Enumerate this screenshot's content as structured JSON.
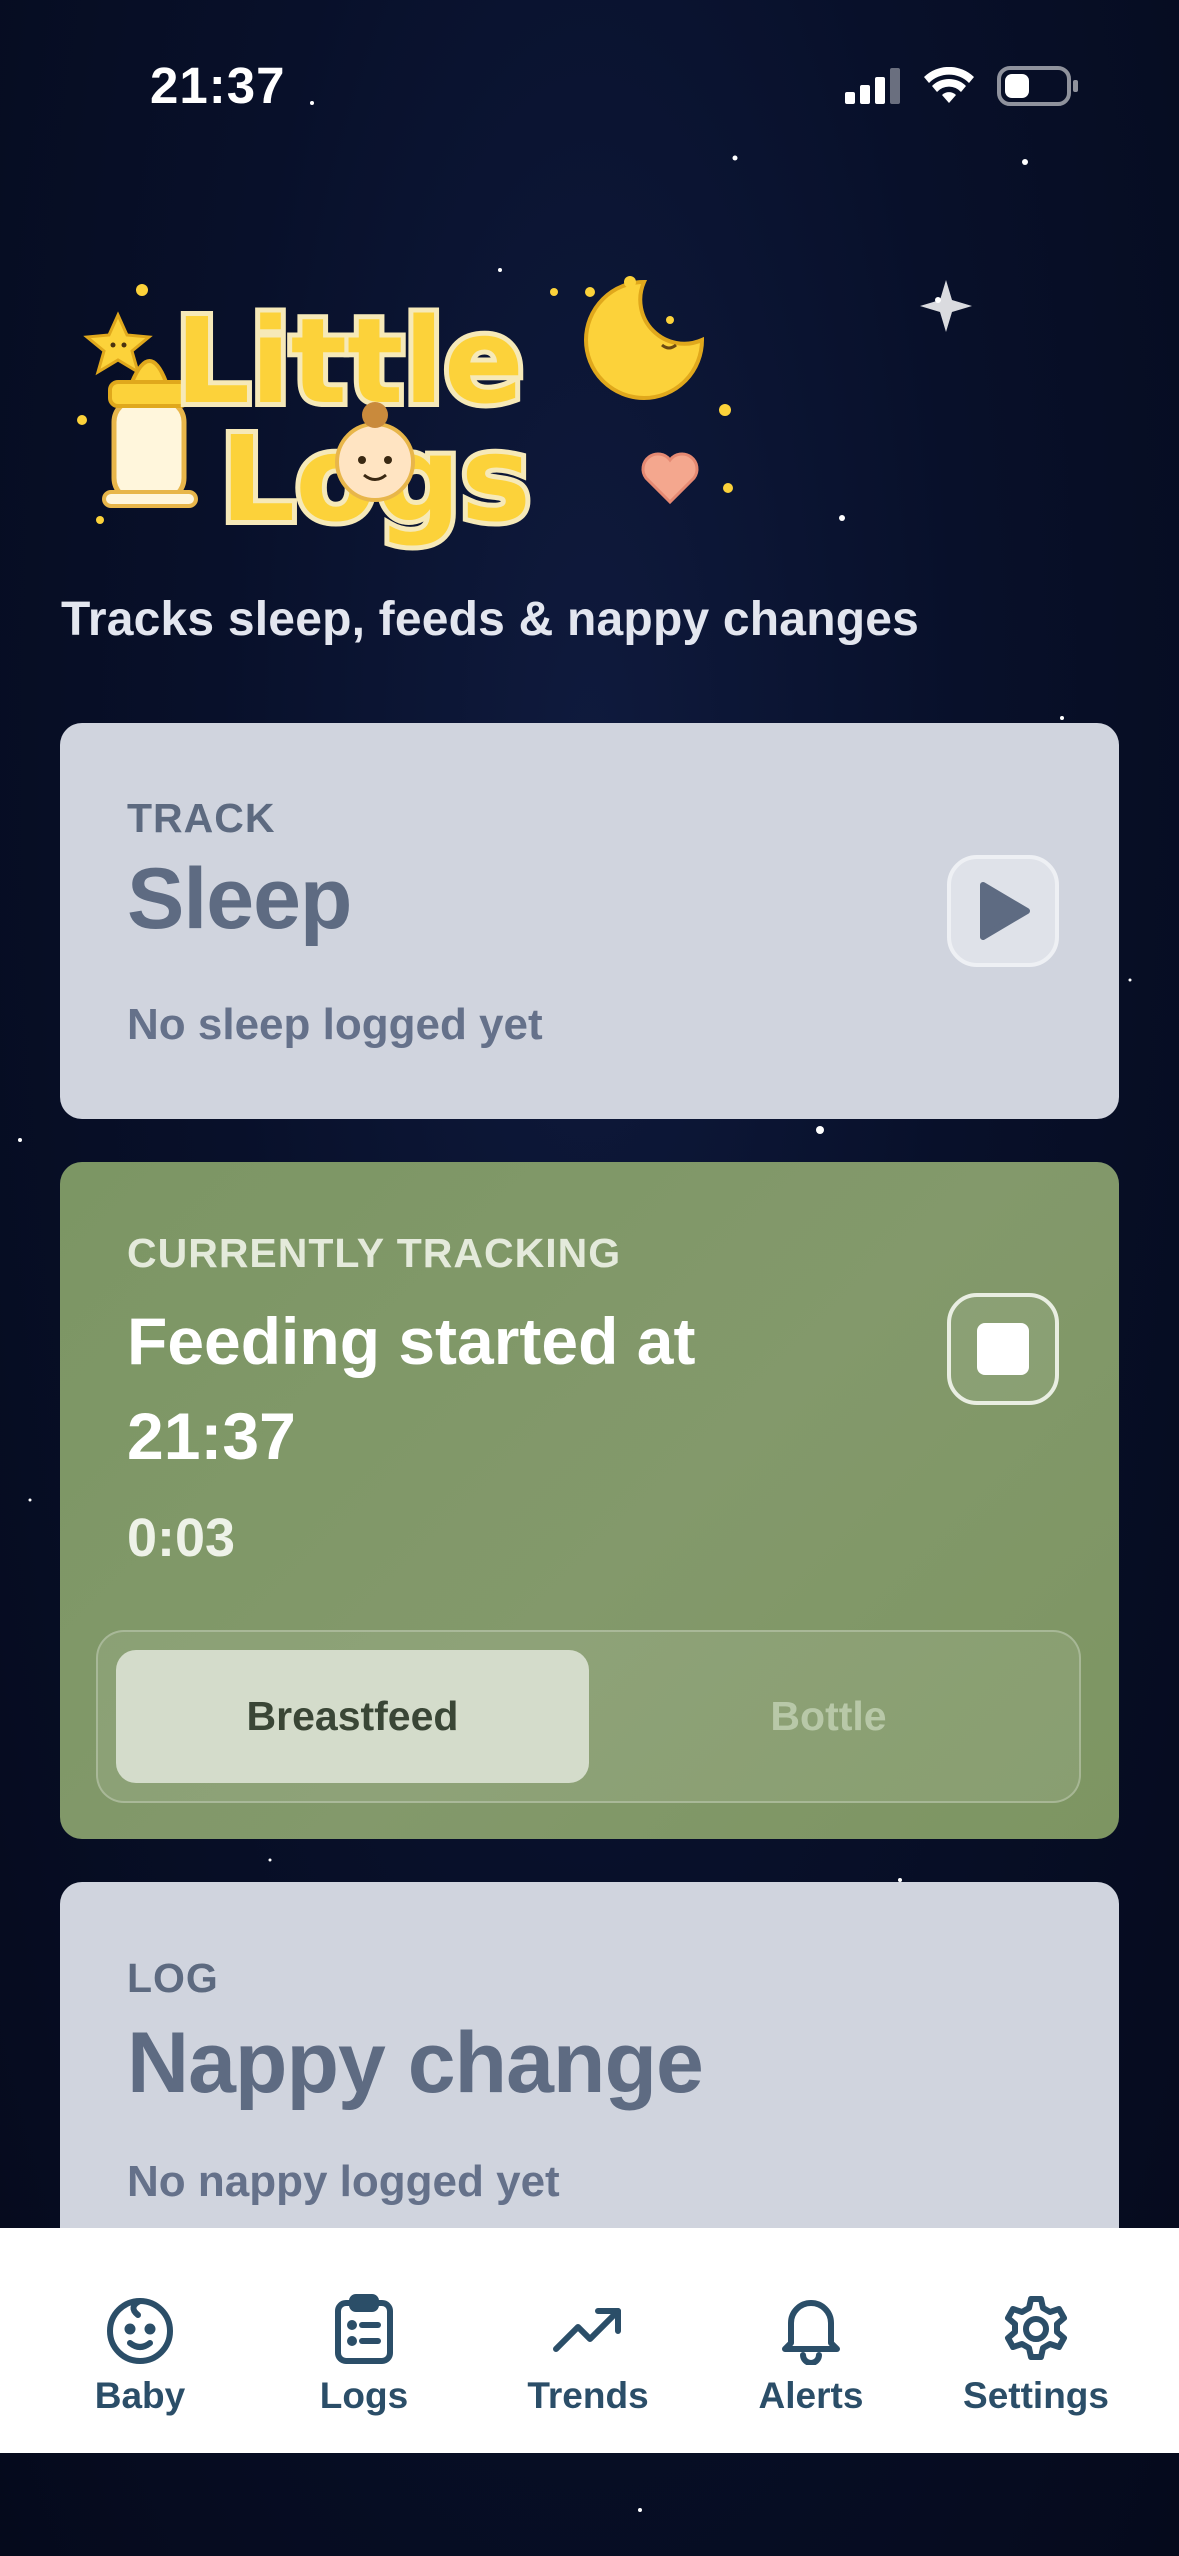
{
  "status_bar": {
    "time": "21:37"
  },
  "header": {
    "logo": {
      "line1": "Little",
      "line2": "Logs"
    },
    "subtitle": "Tracks sleep, feeds & nappy changes"
  },
  "cards": {
    "sleep": {
      "eyebrow": "TRACK",
      "title": "Sleep",
      "subtitle": "No sleep logged yet",
      "action_icon": "play-icon"
    },
    "feeding": {
      "eyebrow": "CURRENTLY TRACKING",
      "title": "Feeding started at 21:37",
      "elapsed": "0:03",
      "action_icon": "stop-icon",
      "options": [
        "Breastfeed",
        "Bottle"
      ],
      "selected_option": "Breastfeed"
    },
    "nappy": {
      "eyebrow": "LOG",
      "title": "Nappy change",
      "subtitle": "No nappy logged yet"
    }
  },
  "tab_bar": {
    "tabs": [
      {
        "label": "Baby",
        "icon": "baby-face-icon"
      },
      {
        "label": "Logs",
        "icon": "clipboard-icon"
      },
      {
        "label": "Trends",
        "icon": "trending-up-icon"
      },
      {
        "label": "Alerts",
        "icon": "bell-icon"
      },
      {
        "label": "Settings",
        "icon": "gear-icon"
      }
    ]
  },
  "colors": {
    "background": "#08102a",
    "card_neutral": "#d0d4de",
    "card_active": "#7f9866",
    "tab_icon": "#2b4e68",
    "logo_yellow": "#fcd23a"
  }
}
